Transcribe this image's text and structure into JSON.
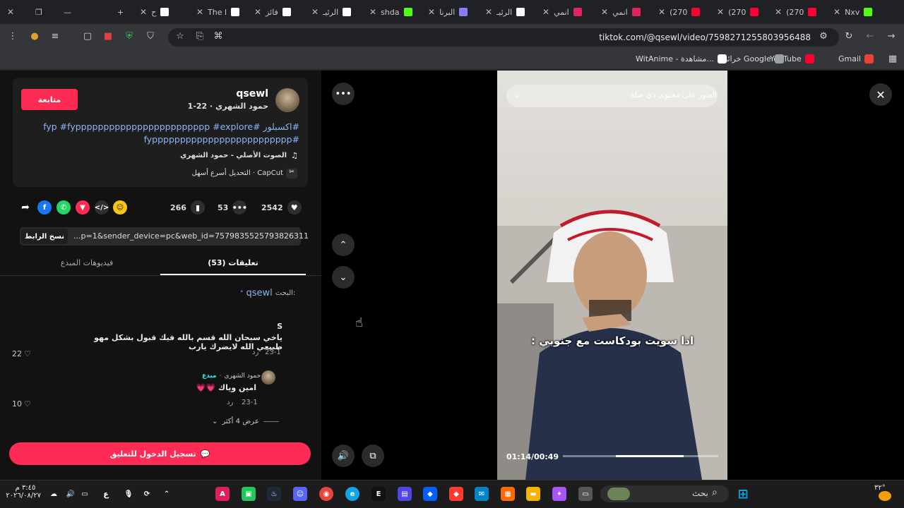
{
  "browser": {
    "tabs": [
      {
        "label": "Nxv",
        "icon": "kick-icon",
        "color": "#53fc18"
      },
      {
        "label": "(270",
        "icon": "youtube-icon",
        "color": "#ff0033"
      },
      {
        "label": "(270",
        "icon": "youtube-icon",
        "color": "#ff0033"
      },
      {
        "label": "(270",
        "icon": "youtube-icon",
        "color": "#ff0033"
      },
      {
        "label": "انمي",
        "icon": "bookmark-red-icon",
        "color": "#e0245e"
      },
      {
        "label": "انمي",
        "icon": "bookmark-red-icon",
        "color": "#e0245e"
      },
      {
        "label": "الرئيـ",
        "icon": "x-icon",
        "color": "#ffffff"
      },
      {
        "label": "البرنا",
        "icon": "grid-icon",
        "color": "#8a7cff"
      },
      {
        "label": "shda",
        "icon": "kick-icon",
        "color": "#53fc18"
      },
      {
        "label": "الرئيـ",
        "icon": "x-icon",
        "color": "#ffffff"
      },
      {
        "label": "فائز",
        "icon": "tiktok-icon",
        "color": "#ffffff"
      },
      {
        "label": "The l",
        "icon": "tiktok-icon",
        "color": "#ffffff"
      },
      {
        "label": "ح",
        "icon": "tiktok-icon",
        "color": "#ffffff"
      }
    ],
    "url": "tiktok.com/@qsewl/video/7598271255803956488",
    "bookmarks": [
      {
        "label": "Gmail",
        "icon": "gmail-icon",
        "color": "#ea4335"
      },
      {
        "label": "YouTube",
        "icon": "youtube-icon",
        "color": "#ff0033"
      },
      {
        "label": "خرائط Google",
        "icon": "maps-icon",
        "color": "#9aa0a6"
      },
      {
        "label": "WitAnime - مشاهدة...",
        "icon": "witanime-icon",
        "color": "#ffffff"
      }
    ]
  },
  "post": {
    "username": "qsewl",
    "display_name_date": "حمود الشهري · 22-1",
    "follow_label": "متابعة",
    "hashtags_line1": "#اكسبلور #fyp #fypppppppppppppppppppppppp #explore",
    "hashtags_line2": "#fyppppppppppppppppppppppppp",
    "sound": "الصوت الأصلي - حمود الشهري",
    "capcut": "CapCut · التحديل أسرع أسهل",
    "likes": "2542",
    "comments_count": "53",
    "saves": "266",
    "link": "...p=1&sender_device=pc&web_id=7579835525793826311",
    "copy_label": "نسخ الرابط"
  },
  "tabs": {
    "comments": "تعليقات (53)",
    "creator_videos": "فيديوهات المبدع"
  },
  "search_hint": {
    "prefix": "البحث:",
    "query": "qsewl"
  },
  "comments": [
    {
      "author": "S",
      "text": "ياخي سبحان الله قسم بالله فيك قبول بشكل مهو طبيعي الله لايضرك يارب",
      "date": "23-1",
      "reply": "رد",
      "likes": "22"
    },
    {
      "author": "حمود الشهري",
      "badge": "مبدع",
      "text": "امين وياك 💗💗",
      "date": "23-1",
      "reply": "رد",
      "likes": "10"
    }
  ],
  "more_replies": "عرض 4 أكثر",
  "login_label": "تسجيل الدخول للتعليق",
  "video": {
    "search_placeholder": "العثور على محتوى ذي صلة",
    "caption": "اذا سويت بودكاست مع جنوبي :",
    "time": "01:14/00:49",
    "progress": 0.66
  },
  "taskbar": {
    "search": "بحث",
    "clock_time": "٣:٤٥ م",
    "clock_date": "٢٠٢٦/٠٨/٢٧",
    "temp": "٣٢°",
    "lang": "ع"
  }
}
